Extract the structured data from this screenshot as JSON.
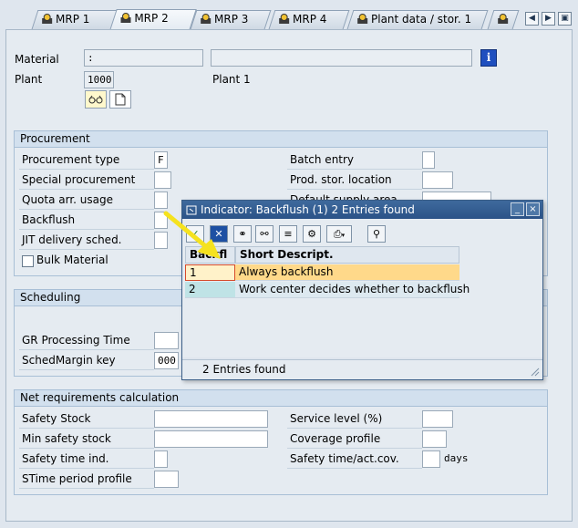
{
  "tabs": [
    {
      "label": "MRP 1"
    },
    {
      "label": "MRP 2"
    },
    {
      "label": "MRP 3"
    },
    {
      "label": "MRP 4"
    },
    {
      "label": "Plant data / stor. 1"
    },
    {
      "label": ""
    }
  ],
  "nav_buttons": [
    "◀",
    "▶",
    "▣"
  ],
  "header": {
    "material_label": "Material",
    "material_value": ":",
    "material_desc": "",
    "plant_label": "Plant",
    "plant_value": "1000",
    "plant_desc": "Plant 1",
    "info_glyph": "i"
  },
  "procurement": {
    "title": "Procurement",
    "procurement_type_label": "Procurement type",
    "procurement_type_value": "F",
    "special_procurement_label": "Special procurement",
    "quota_label": "Quota arr. usage",
    "backflush_label": "Backflush",
    "jit_label": "JIT delivery sched.",
    "bulk_label": "Bulk Material",
    "batch_entry_label": "Batch entry",
    "prod_stor_label": "Prod. stor. location",
    "default_supply_label": "Default supply area"
  },
  "scheduling": {
    "title": "Scheduling",
    "gr_time_label": "GR Processing Time",
    "sched_margin_label": "SchedMargin key",
    "sched_margin_value": "000"
  },
  "net_req": {
    "title": "Net requirements calculation",
    "safety_stock_label": "Safety Stock",
    "min_safety_label": "Min safety stock",
    "safety_time_ind_label": "Safety time ind.",
    "stime_period_label": "STime period profile",
    "service_level_label": "Service level (%)",
    "coverage_label": "Coverage profile",
    "safety_time_cov_label": "Safety time/act.cov.",
    "days_label": "days"
  },
  "popup": {
    "title": "Indicator: Backflush (1)    2 Entries found",
    "col1": "Backfl",
    "col2": "Short Descript.",
    "rows": [
      {
        "key": "1",
        "desc": "Always backflush"
      },
      {
        "key": "2",
        "desc": "Work center decides whether to backflush"
      }
    ],
    "footer": "2 Entries found",
    "minimize": "_",
    "close": "×"
  },
  "colors": {
    "selected_row": "#ffd98a",
    "second_row": "#bfe3e6",
    "title_bar": "#2f5a8f",
    "annotation_arrow": "#f5e21e"
  }
}
